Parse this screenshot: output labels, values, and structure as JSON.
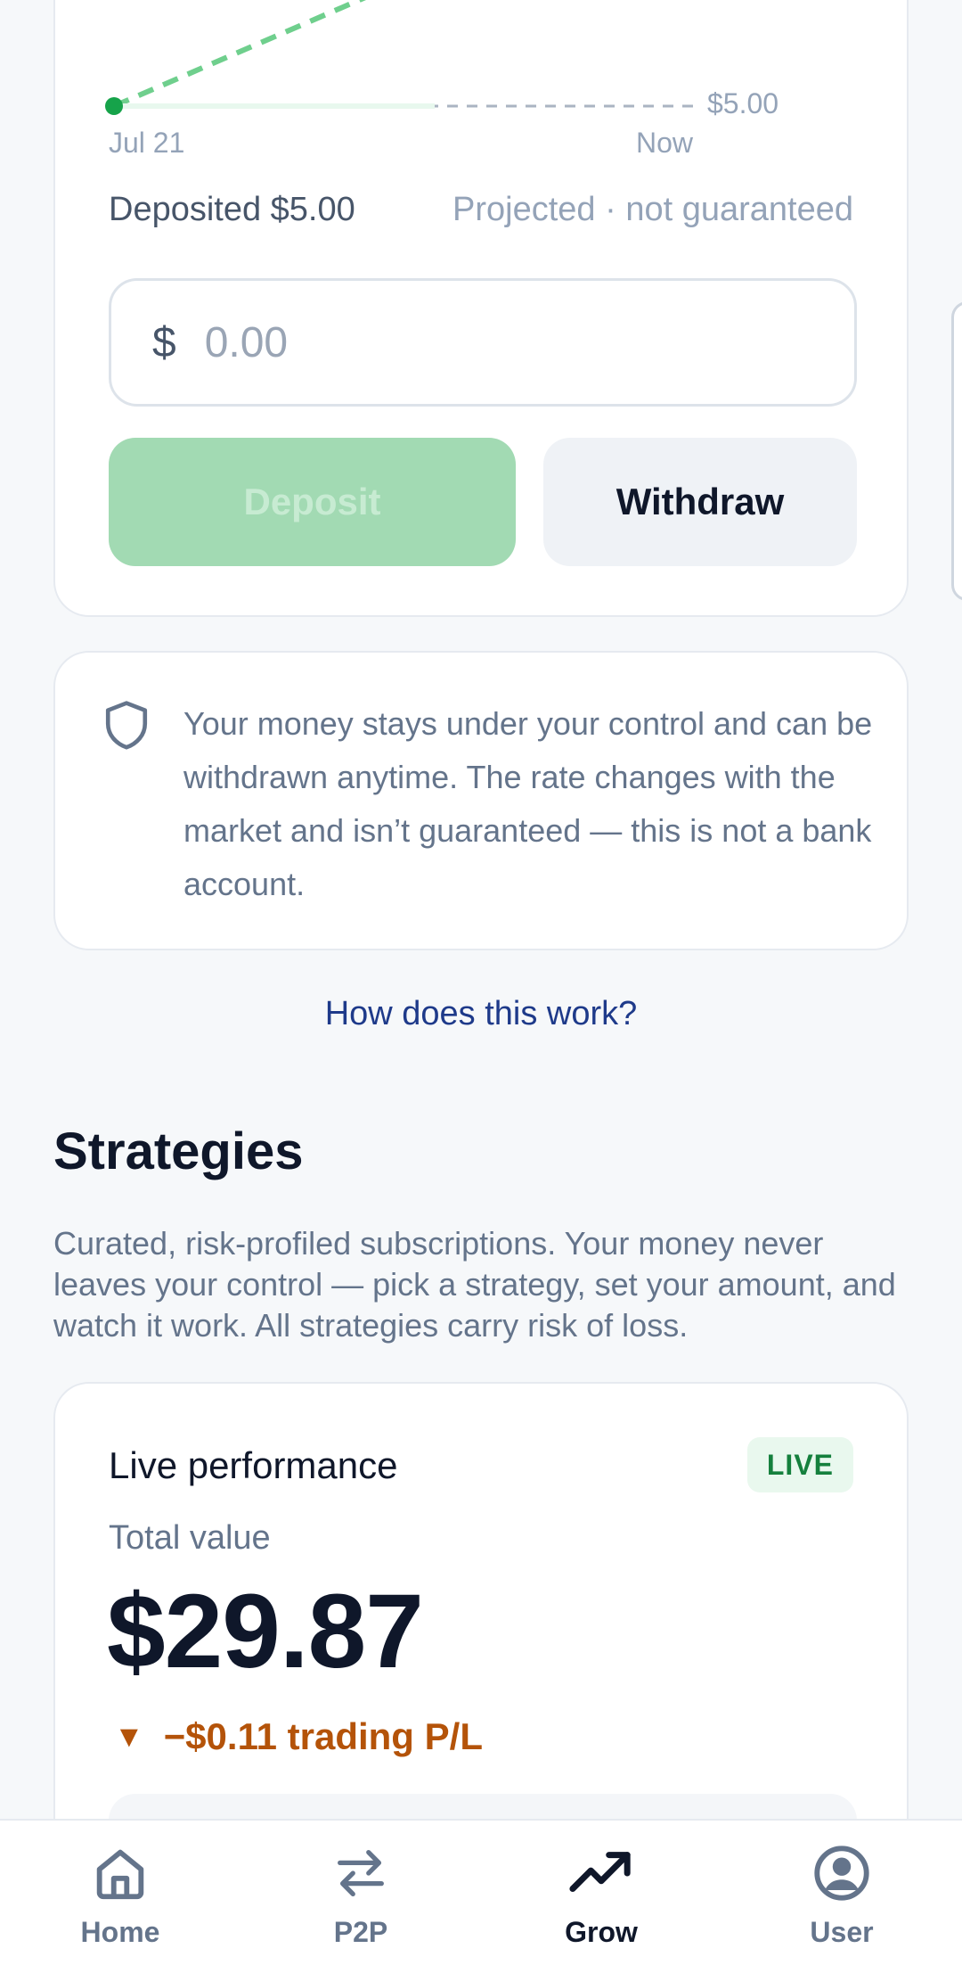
{
  "chart": {
    "start_label": "Jul 21",
    "end_label": "Now",
    "value_label": "$5.00",
    "colors": {
      "line": "#4ade80",
      "start_dot": "#16a34a",
      "baseline": "#94a3b8"
    }
  },
  "summary": {
    "deposited": "Deposited $5.00",
    "projected": "Projected · not guaranteed"
  },
  "amount": {
    "currency": "$",
    "placeholder": "0.00",
    "value": ""
  },
  "actions": {
    "deposit_label": "Deposit",
    "withdraw_label": "Withdraw"
  },
  "info": {
    "icon": "shield-icon",
    "text": "Your money stays under your control and can be withdrawn anytime. The rate changes with the market and isn’t guaranteed — this is not a bank account."
  },
  "help_link": "How does this work?",
  "strategies": {
    "title": "Strategies",
    "description": "Curated, risk-profiled subscriptions. Your money never leaves your control — pick a strategy, set your amount, and watch it work. All strategies carry risk of loss."
  },
  "live": {
    "title": "Live performance",
    "badge": "LIVE",
    "total_label": "Total value",
    "total_value": "$29.87",
    "pl_arrow": "▼",
    "pl_text": "−$0.11 trading P/L",
    "colors": {
      "badge_bg": "#e9f8ee",
      "badge_text": "#15803d",
      "pl": "#b45309"
    }
  },
  "nav": {
    "items": [
      {
        "label": "Home",
        "icon": "home-icon",
        "active": false
      },
      {
        "label": "P2P",
        "icon": "swap-arrows-icon",
        "active": false
      },
      {
        "label": "Grow",
        "icon": "trending-up-icon",
        "active": true
      },
      {
        "label": "User",
        "icon": "user-circle-icon",
        "active": false
      }
    ]
  }
}
